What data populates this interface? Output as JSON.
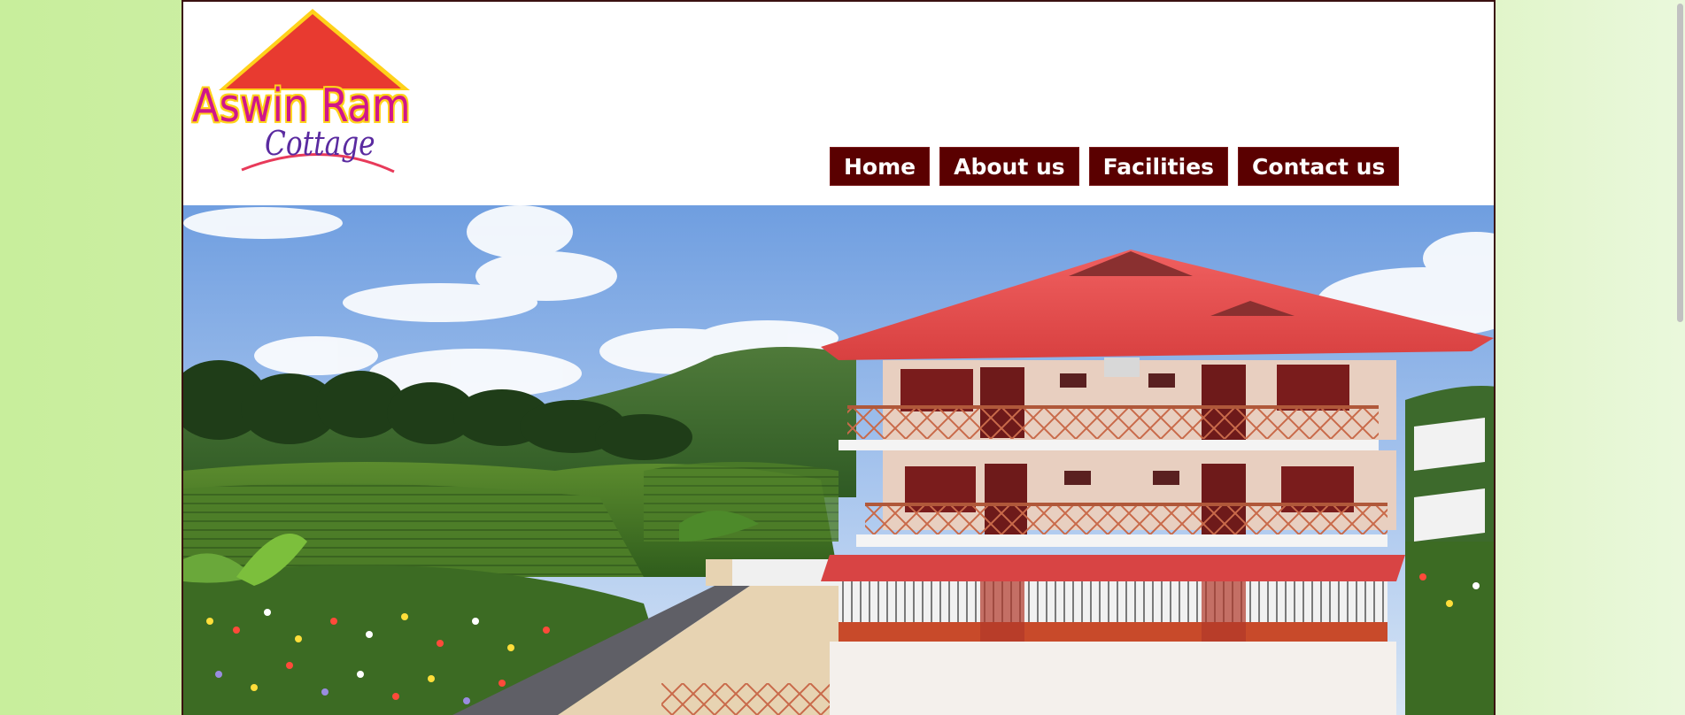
{
  "logo": {
    "name": "Aswin Ram",
    "tagline": "Cottage"
  },
  "nav": {
    "items": [
      {
        "label": "Home"
      },
      {
        "label": "About us"
      },
      {
        "label": "Facilities"
      },
      {
        "label": "Contact us"
      }
    ]
  },
  "colors": {
    "nav_background": "#5a0000",
    "roof": "#e25050",
    "logo_text": "#d0168a",
    "logo_outline": "#ffd21a",
    "page_background": "#cdefa6"
  },
  "icons": {
    "logo_roof": "triangle-roof-icon",
    "logo_swoosh": "arc-swoosh-icon"
  }
}
